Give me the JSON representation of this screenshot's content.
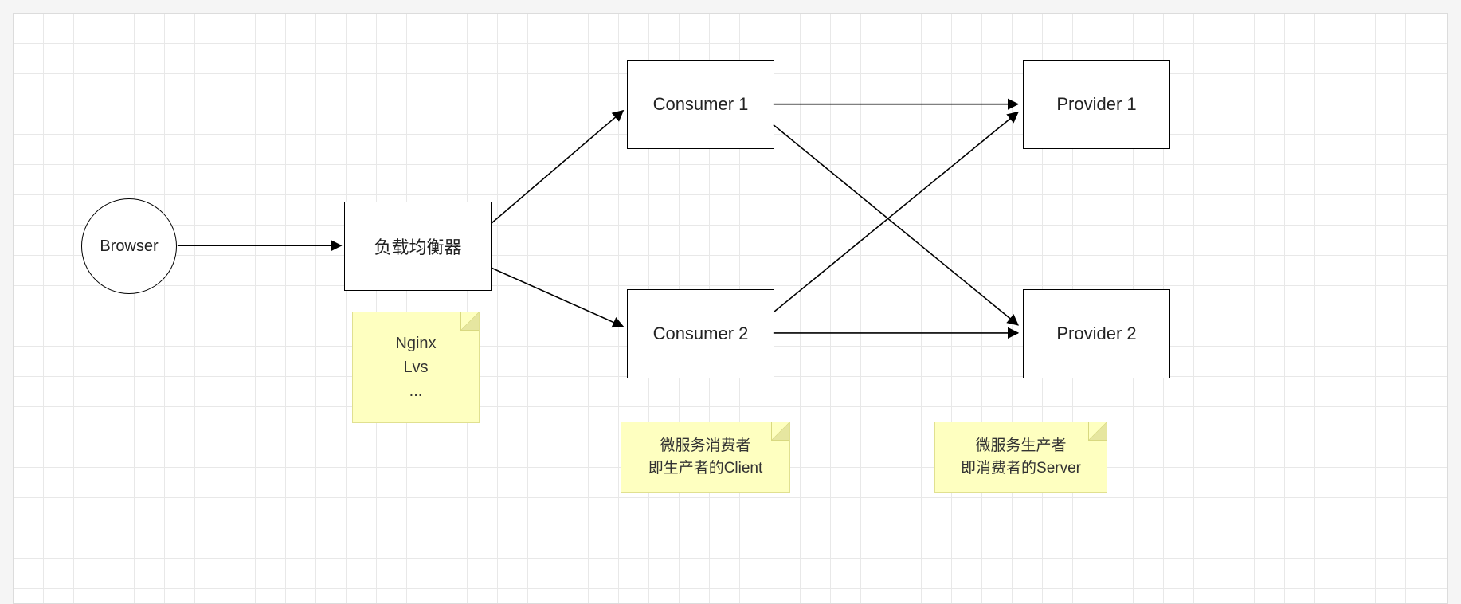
{
  "nodes": {
    "browser": {
      "label": "Browser"
    },
    "loadBalancer": {
      "label": "负载均衡器"
    },
    "consumer1": {
      "label": "Consumer 1"
    },
    "consumer2": {
      "label": "Consumer 2"
    },
    "provider1": {
      "label": "Provider 1"
    },
    "provider2": {
      "label": "Provider 2"
    }
  },
  "stickies": {
    "lbNote": {
      "line1": "Nginx",
      "line2": "Lvs",
      "line3": "..."
    },
    "consumerNote": {
      "line1": "微服务消费者",
      "line2": "即生产者的Client"
    },
    "providerNote": {
      "line1": "微服务生产者",
      "line2": "即消费者的Server"
    }
  },
  "chart_data": {
    "type": "diagram",
    "title": "",
    "nodes": [
      {
        "id": "browser",
        "label": "Browser",
        "shape": "circle"
      },
      {
        "id": "loadBalancer",
        "label": "负载均衡器",
        "shape": "rect",
        "note": "Nginx\nLvs\n..."
      },
      {
        "id": "consumer1",
        "label": "Consumer 1",
        "shape": "rect"
      },
      {
        "id": "consumer2",
        "label": "Consumer 2",
        "shape": "rect"
      },
      {
        "id": "provider1",
        "label": "Provider 1",
        "shape": "rect"
      },
      {
        "id": "provider2",
        "label": "Provider 2",
        "shape": "rect"
      }
    ],
    "edges": [
      {
        "from": "browser",
        "to": "loadBalancer",
        "directed": true
      },
      {
        "from": "loadBalancer",
        "to": "consumer1",
        "directed": true
      },
      {
        "from": "loadBalancer",
        "to": "consumer2",
        "directed": true
      },
      {
        "from": "consumer1",
        "to": "provider1",
        "directed": true
      },
      {
        "from": "consumer1",
        "to": "provider2",
        "directed": true
      },
      {
        "from": "consumer2",
        "to": "provider1",
        "directed": true
      },
      {
        "from": "consumer2",
        "to": "provider2",
        "directed": true
      }
    ],
    "annotations": [
      {
        "target": "loadBalancer",
        "text": "Nginx\nLvs\n..."
      },
      {
        "target": "consumers",
        "text": "微服务消费者 即生产者的Client"
      },
      {
        "target": "providers",
        "text": "微服务生产者 即消费者的Server"
      }
    ]
  }
}
